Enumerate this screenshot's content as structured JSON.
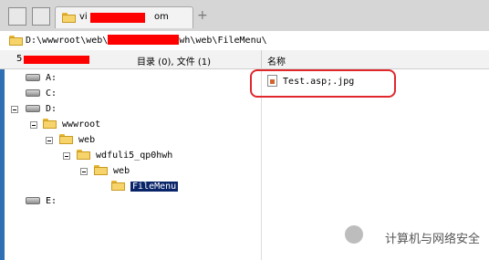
{
  "tab": {
    "title": "vi"
  },
  "toolbar": {
    "new_tab": "+"
  },
  "address": {
    "path_start": "D:\\wwwroot\\web\\",
    "path_end": "wh\\web\\FileMenu\\"
  },
  "header": {
    "left_prefix": "5",
    "counts": "目录 (0), 文件 (1)",
    "name_col": "名称"
  },
  "tree": {
    "a": "A:",
    "c": "C:",
    "d": "D:",
    "wwwroot": "wwwroot",
    "web": "web",
    "wdfuli": "wdfuli5_qp0hwh",
    "web2": "web",
    "filemenu": "FileMenu",
    "e": "E:"
  },
  "files": [
    {
      "name": "Test.asp;.jpg"
    }
  ],
  "watermark": "计算机与网络安全"
}
